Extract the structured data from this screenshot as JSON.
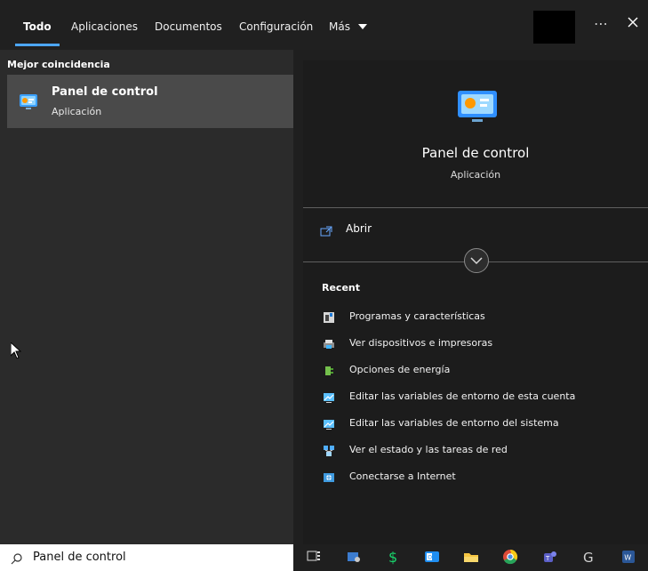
{
  "tabs": [
    {
      "label": "Todo"
    },
    {
      "label": "Aplicaciones"
    },
    {
      "label": "Documentos"
    },
    {
      "label": "Configuración"
    },
    {
      "label": "Más"
    }
  ],
  "section": {
    "best_match_title": "Mejor coincidencia"
  },
  "best_match": {
    "title": "Panel de control",
    "subtitle": "Aplicación"
  },
  "detail": {
    "title": "Panel de control",
    "subtitle": "Aplicación",
    "open_label": "Abrir",
    "recent_heading": "Recent"
  },
  "recent_items": [
    {
      "label": "Programas y características",
      "icon": "programs-icon"
    },
    {
      "label": "Ver dispositivos e impresoras",
      "icon": "devices-printers-icon"
    },
    {
      "label": "Opciones de energía",
      "icon": "power-options-icon"
    },
    {
      "label": "Editar las variables de entorno de esta cuenta",
      "icon": "environment-variables-account-icon"
    },
    {
      "label": "Editar las variables de entorno del sistema",
      "icon": "environment-variables-system-icon"
    },
    {
      "label": "Ver el estado y las tareas de red",
      "icon": "network-status-icon"
    },
    {
      "label": "Conectarse a Internet",
      "icon": "internet-connect-icon"
    }
  ],
  "search": {
    "value": "Panel de control"
  },
  "taskbar_icons": [
    "task-view-icon",
    "user-app-icon",
    "money-app-icon",
    "outlook-icon",
    "file-explorer-icon",
    "chrome-icon",
    "teams-icon",
    "google-icon",
    "word-icon"
  ],
  "colors": {
    "accent": "#4ca6ff",
    "selected_item": "#4a4a4a",
    "left_panel": "#2b2b2b",
    "right_panel": "#1c1c1c",
    "taskbar": "#1f1f1f"
  }
}
